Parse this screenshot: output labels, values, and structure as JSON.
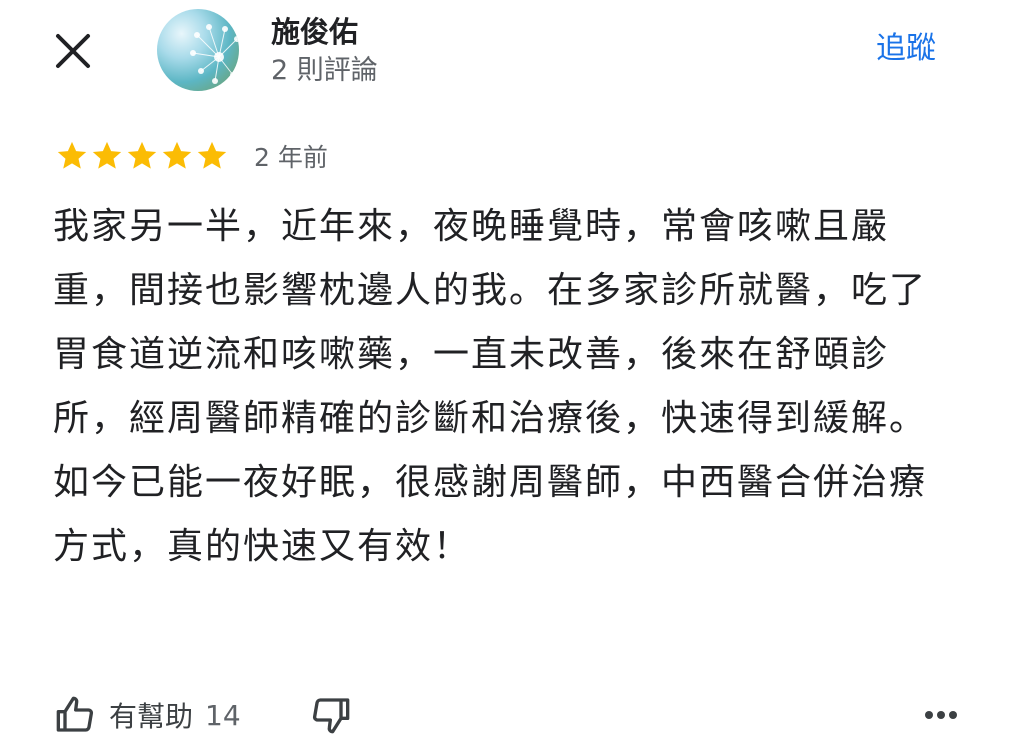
{
  "header": {
    "author_name": "施俊佑",
    "review_count": "2 則評論",
    "follow_label": "追蹤",
    "close_icon": "close-icon",
    "avatar_icon": "avatar"
  },
  "review": {
    "rating": 5,
    "max_rating": 5,
    "star_color": "#fbbc04",
    "time": "2 年前",
    "text": "我家另一半，近年來，夜晚睡覺時，常會咳嗽且嚴重，間接也影響枕邊人的我。在多家診所就醫，吃了胃食道逆流和咳嗽藥，一直未改善，後來在舒頤診所，經周醫師精確的診斷和治療後，快速得到緩解。如今已能一夜好眠，很感謝周醫師，中西醫合併治療方式，真的快速又有效！"
  },
  "actions": {
    "helpful_label": "有幫助",
    "helpful_count": "14",
    "like_icon": "thumb-up-icon",
    "dislike_icon": "thumb-down-icon",
    "more_icon": "more-horizontal-icon"
  },
  "colors": {
    "accent": "#1a73e8",
    "star": "#fbbc04",
    "secondary_text": "#5f6368"
  }
}
